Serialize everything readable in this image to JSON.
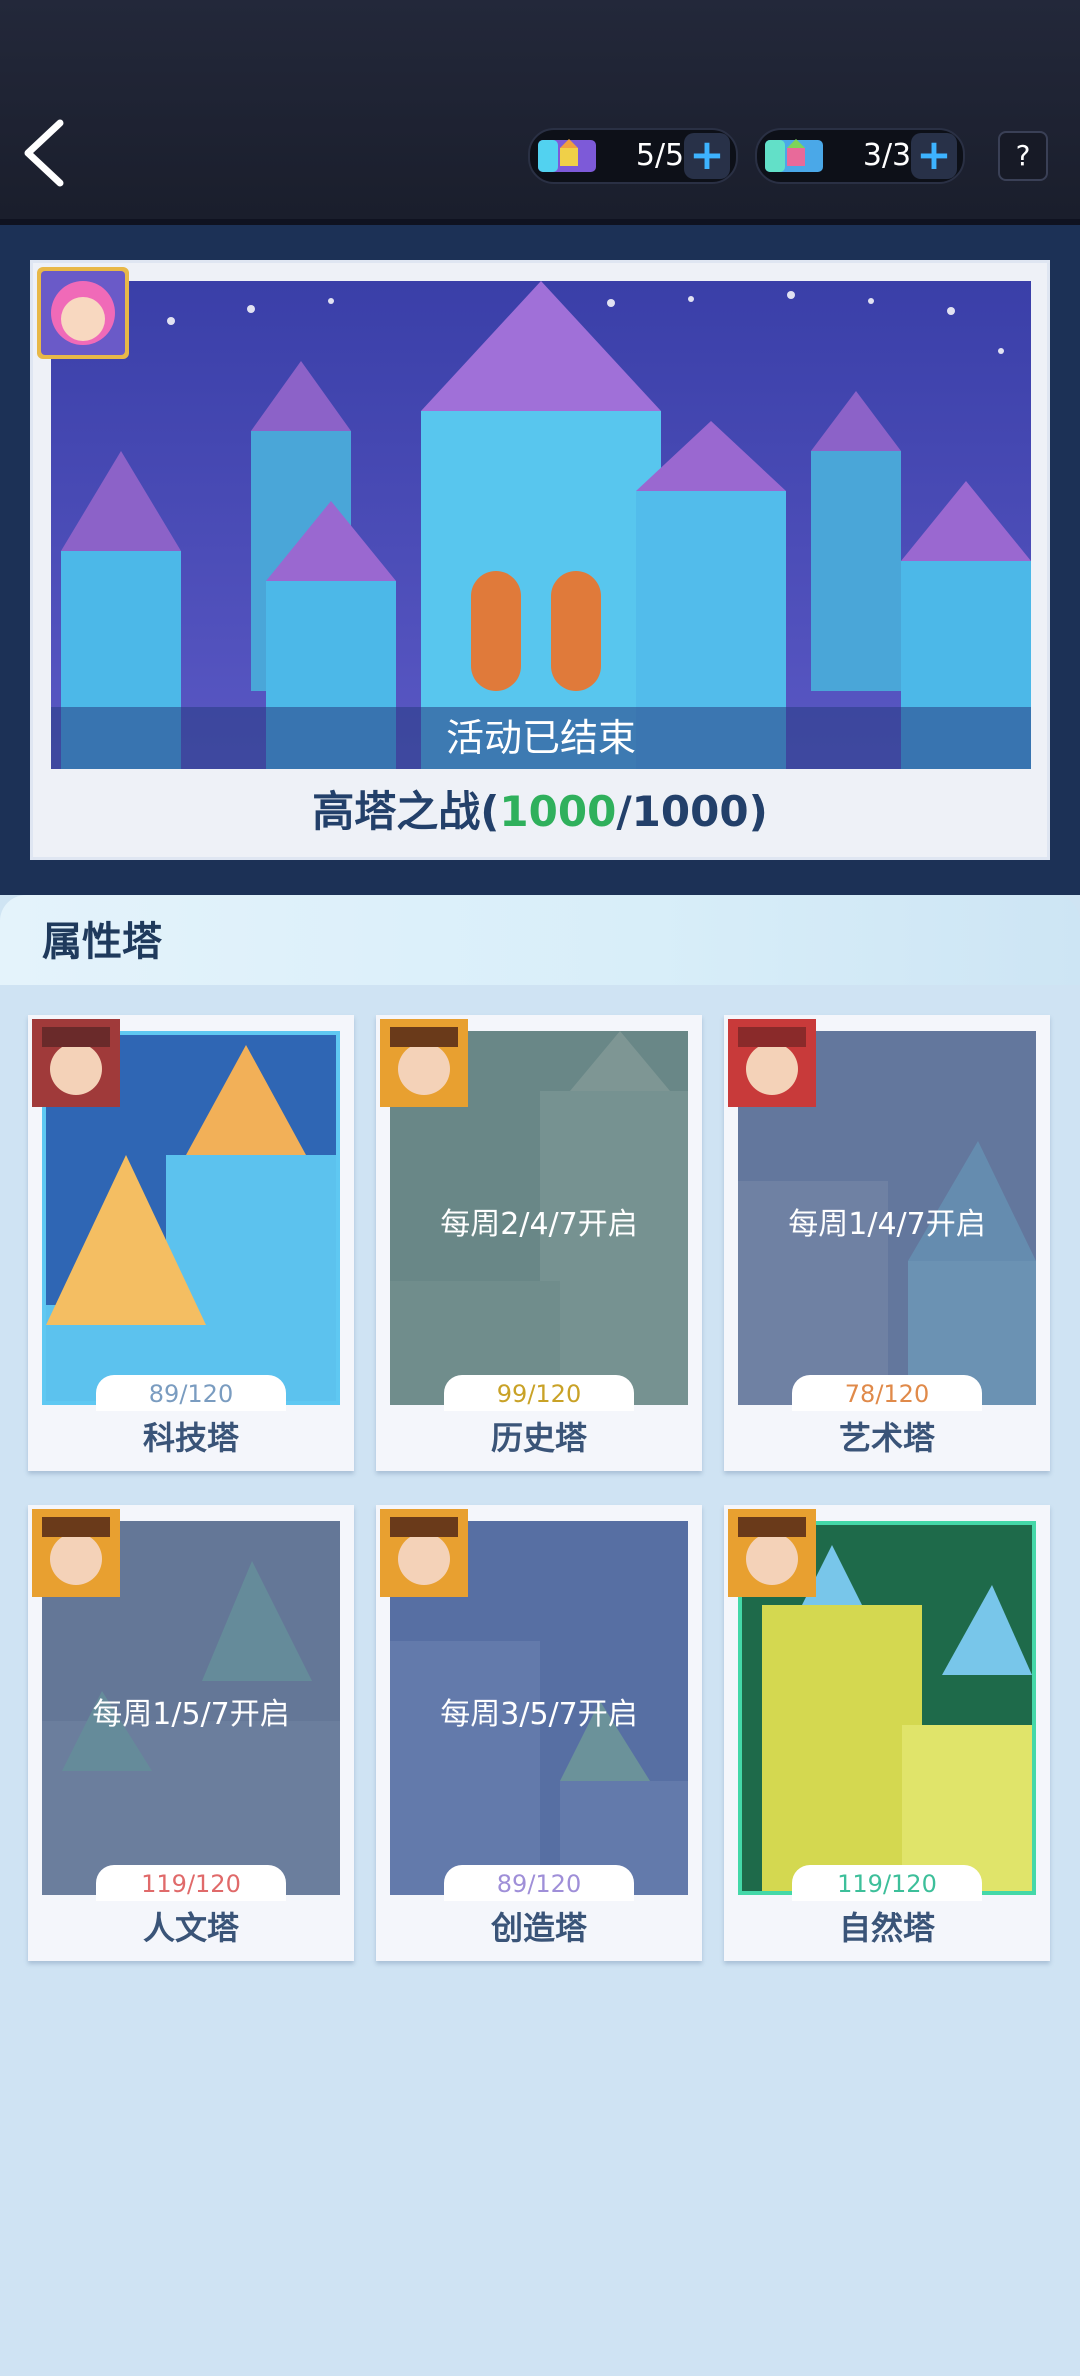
{
  "header": {
    "ticket1": {
      "count": "5/5",
      "icon": "castle-ticket-icon",
      "plus": "+"
    },
    "ticket2": {
      "count": "3/3",
      "icon": "castle-ticket-icon",
      "plus": "+"
    },
    "help": "?"
  },
  "event": {
    "status": "活动已结束",
    "title_prefix": "高塔之战(",
    "current": "1000",
    "title_suffix": "/1000)"
  },
  "section": {
    "title": "属性塔"
  },
  "towers": [
    {
      "name": "科技塔",
      "progress": "89/120",
      "schedule": "",
      "locked": false,
      "progress_color": "#7a9cc0"
    },
    {
      "name": "历史塔",
      "progress": "99/120",
      "schedule": "每周2/4/7开启",
      "locked": true,
      "progress_color": "#c9a227"
    },
    {
      "name": "艺术塔",
      "progress": "78/120",
      "schedule": "每周1/4/7开启",
      "locked": true,
      "progress_color": "#e08a4a"
    },
    {
      "name": "人文塔",
      "progress": "119/120",
      "schedule": "每周1/5/7开启",
      "locked": true,
      "progress_color": "#e06a6a"
    },
    {
      "name": "创造塔",
      "progress": "89/120",
      "schedule": "每周3/5/7开启",
      "locked": true,
      "progress_color": "#9f8fd8"
    },
    {
      "name": "自然塔",
      "progress": "119/120",
      "schedule": "",
      "locked": false,
      "progress_color": "#3dbf9a"
    }
  ],
  "colors": {
    "accent_green": "#2fb05c",
    "plus_blue": "#3db3ff",
    "navy": "#1c3156"
  }
}
